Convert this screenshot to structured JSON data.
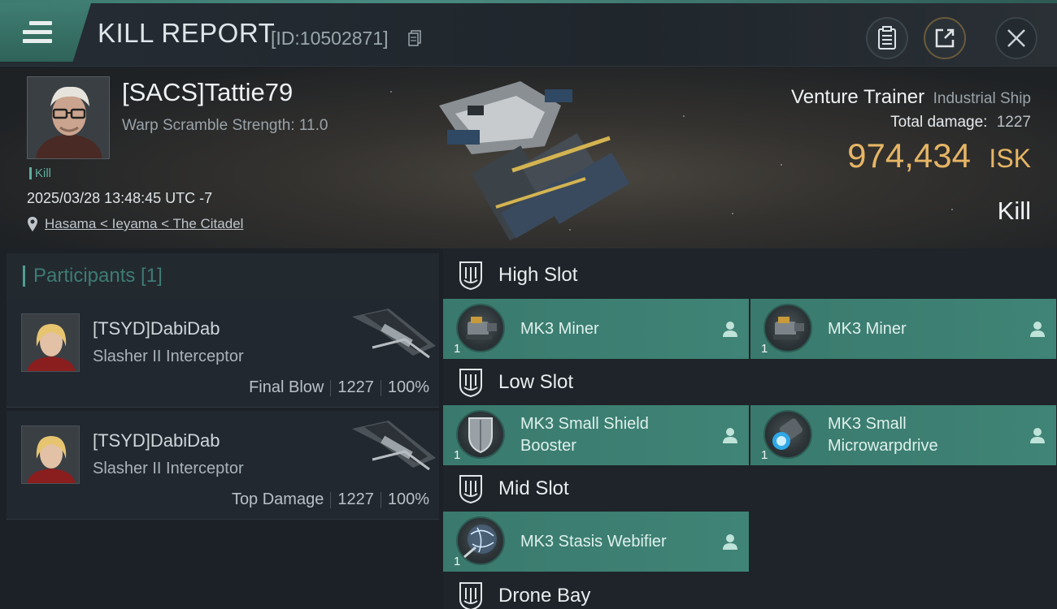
{
  "header": {
    "title": "KILL REPORT",
    "report_id": "[ID:10502871]"
  },
  "victim": {
    "pilot_name": "[SACS]Tattie79",
    "warp_scramble": "Warp Scramble Strength: 11.0",
    "kill_tag": "Kill",
    "datetime": "2025/03/28 13:48:45 UTC -7",
    "location": "Hasama < Ieyama < The Citadel",
    "ship_name": "Venture Trainer",
    "ship_class": "Industrial Ship",
    "total_damage_label": "Total damage:",
    "total_damage_value": "1227",
    "isk_value": "974,434",
    "isk_unit": "ISK",
    "result": "Kill"
  },
  "participants": {
    "heading": "Participants [1]",
    "rows": [
      {
        "name": "[TSYD]DabiDab",
        "ship": "Slasher II Interceptor",
        "role": "Final Blow",
        "damage": "1227",
        "percent": "100%"
      },
      {
        "name": "[TSYD]DabiDab",
        "ship": "Slasher II Interceptor",
        "role": "Top Damage",
        "damage": "1227",
        "percent": "100%"
      }
    ]
  },
  "slots": {
    "high": {
      "label": "High Slot",
      "modules": [
        {
          "name": "MK3 Miner",
          "qty": "1"
        },
        {
          "name": "MK3 Miner",
          "qty": "1"
        }
      ]
    },
    "low": {
      "label": "Low Slot",
      "modules": [
        {
          "name": "MK3 Small Shield Booster",
          "qty": "1"
        },
        {
          "name": "MK3 Small Microwarpdrive",
          "qty": "1"
        }
      ]
    },
    "mid": {
      "label": "Mid Slot",
      "modules": [
        {
          "name": "MK3 Stasis Webifier",
          "qty": "1"
        }
      ]
    },
    "drone": {
      "label": "Drone Bay"
    }
  },
  "colors": {
    "accent_teal": "#3f8476",
    "isk_gold": "#e6b565"
  }
}
